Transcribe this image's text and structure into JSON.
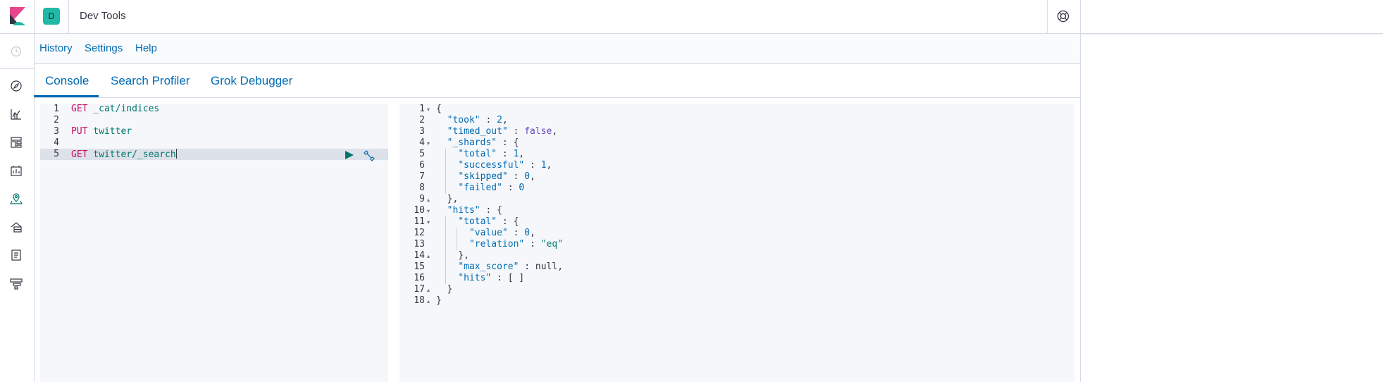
{
  "header": {
    "space_initial": "D",
    "app_title": "Dev Tools",
    "help_icon": "help-menu-icon"
  },
  "leftnav": {
    "icons": [
      "recently-viewed-icon",
      "discover-icon",
      "visualize-icon",
      "dashboard-icon",
      "canvas-icon",
      "maps-icon",
      "infrastructure-icon",
      "logs-icon",
      "apm-icon"
    ]
  },
  "topmenu": {
    "history": "History",
    "settings": "Settings",
    "help": "Help"
  },
  "tabs": [
    "Console",
    "Search Profiler",
    "Grok Debugger"
  ],
  "editor": {
    "line_numbers": [
      "1",
      "2",
      "3",
      "4",
      "5"
    ],
    "lines": [
      {
        "method": "GET",
        "url": " _cat/indices"
      },
      {
        "method": "",
        "url": ""
      },
      {
        "method": "PUT",
        "url": " twitter"
      },
      {
        "method": "",
        "url": ""
      },
      {
        "method": "GET",
        "url": " twitter/_search"
      }
    ],
    "active_line": 5,
    "actions": [
      "play-icon",
      "wrench-icon"
    ]
  },
  "output": {
    "line_numbers": [
      "1",
      "2",
      "3",
      "4",
      "5",
      "6",
      "7",
      "8",
      "9",
      "10",
      "11",
      "12",
      "13",
      "14",
      "15",
      "16",
      "17",
      "18"
    ],
    "lines": [
      "{",
      "  \"took\" : 2,",
      "  \"timed_out\" : false,",
      "  \"_shards\" : {",
      "    \"total\" : 1,",
      "    \"successful\" : 1,",
      "    \"skipped\" : 0,",
      "    \"failed\" : 0",
      "  },",
      "  \"hits\" : {",
      "    \"total\" : {",
      "      \"value\" : 0,",
      "      \"relation\" : \"eq\"",
      "    },",
      "    \"max_score\" : null,",
      "    \"hits\" : [ ]",
      "  }",
      "}"
    ]
  },
  "colors": {
    "link": "#006bb4",
    "method": "#c80a68",
    "url": "#00756c",
    "avatar": "#20b8a6"
  }
}
